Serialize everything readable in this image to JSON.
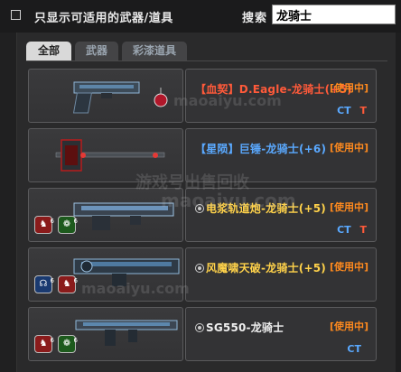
{
  "filter": {
    "label": "只显示可适用的武器/道具"
  },
  "search": {
    "label": "搜索",
    "value": "龙骑士"
  },
  "tabs": [
    {
      "label": "全部"
    },
    {
      "label": "武器"
    },
    {
      "label": "彩漆道具"
    }
  ],
  "items": [
    {
      "name": "【血契】D.Eagle-龙骑士(+5)",
      "status": "[使用中]",
      "tag_ct": "CT",
      "tag_t": "T",
      "name_color": "#ff5a3a",
      "icon": "pistol-icon"
    },
    {
      "name": "【星陨】巨锤-龙骑士(+6)",
      "status": "[使用中]",
      "tag_ct": "",
      "tag_t": "",
      "name_color": "#5aa9ff",
      "icon": "hammer-icon"
    },
    {
      "name": "电浆轨道炮-龙骑士(+5)",
      "status": "[使用中]",
      "tag_ct": "CT",
      "tag_t": "T",
      "name_color": "#ffd24a",
      "icon": "railgun-icon"
    },
    {
      "name": "风魔啸天破-龙骑士(+5)",
      "status": "[使用中]",
      "tag_ct": "",
      "tag_t": "",
      "name_color": "#ffd24a",
      "icon": "launcher-icon"
    },
    {
      "name": "SG550-龙骑士",
      "status": "[使用中]",
      "tag_ct": "CT",
      "tag_t": "",
      "name_color": "#f0f0f0",
      "icon": "rifle-icon"
    }
  ],
  "watermarks": [
    "maoaiyu.com",
    "游戏号出售回收",
    "maoaiyu.com",
    "maoaiyu.com"
  ]
}
